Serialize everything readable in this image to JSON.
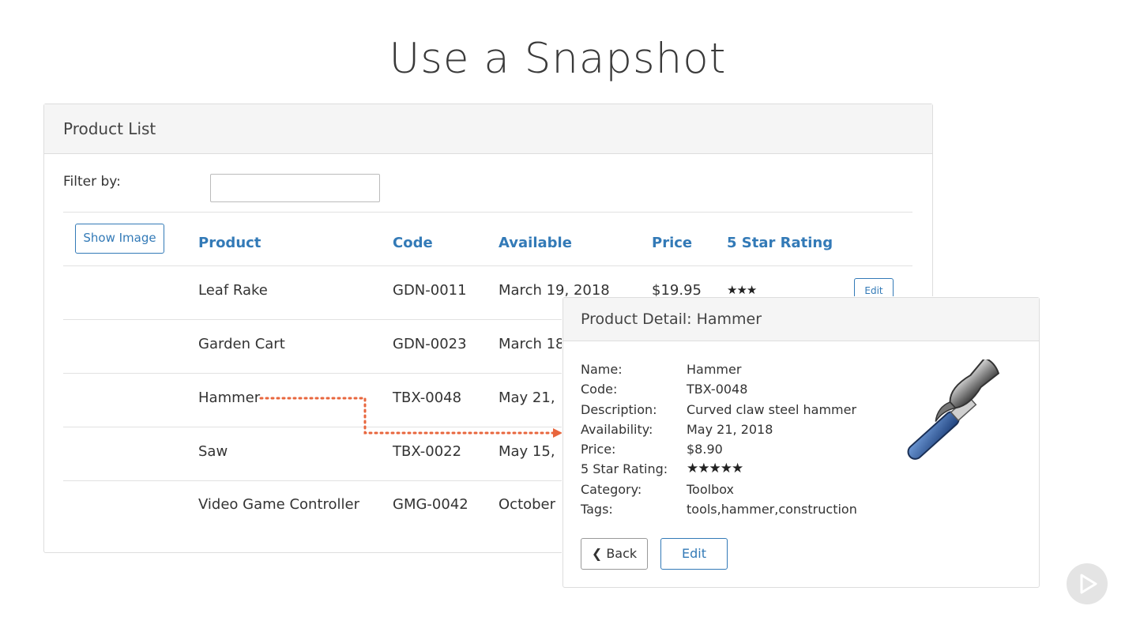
{
  "slide_title": "Use a Snapshot",
  "product_list": {
    "title": "Product List",
    "filter_label": "Filter by:",
    "filter_value": "",
    "show_image_label": "Show Image",
    "columns": [
      "Product",
      "Code",
      "Available",
      "Price",
      "5 Star Rating"
    ],
    "rows": [
      {
        "product": "Leaf Rake",
        "code": "GDN-0011",
        "available": "March 19, 2018",
        "price": "$19.95",
        "stars": "★★★"
      },
      {
        "product": "Garden Cart",
        "code": "GDN-0023",
        "available": "March 18"
      },
      {
        "product": "Hammer",
        "code": "TBX-0048",
        "available": "May 21,"
      },
      {
        "product": "Saw",
        "code": "TBX-0022",
        "available": "May 15,"
      },
      {
        "product": "Video Game Controller",
        "code": "GMG-0042",
        "available": "October"
      }
    ],
    "edit_label": "Edit"
  },
  "detail": {
    "title": "Product Detail: Hammer",
    "fields": [
      {
        "label": "Name:",
        "value": "Hammer"
      },
      {
        "label": "Code:",
        "value": "TBX-0048"
      },
      {
        "label": "Description:",
        "value": "Curved claw steel hammer"
      },
      {
        "label": "Availability:",
        "value": "May 21, 2018"
      },
      {
        "label": "Price:",
        "value": "$8.90"
      },
      {
        "label": "5 Star Rating:",
        "value": "★★★★★"
      },
      {
        "label": "Category:",
        "value": "Toolbox"
      },
      {
        "label": "Tags:",
        "value": "tools,hammer,construction"
      }
    ],
    "back_label": "Back",
    "edit_label": "Edit",
    "image_icon": "hammer-icon"
  },
  "colors": {
    "link_blue": "#337ab7",
    "arrow_orange": "#e8663d"
  }
}
